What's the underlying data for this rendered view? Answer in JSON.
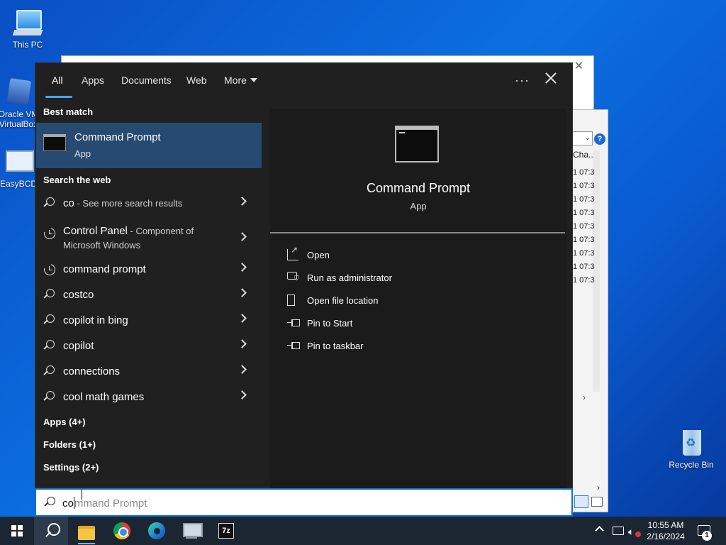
{
  "desktop": {
    "icons": [
      {
        "label": "This PC"
      },
      {
        "label": "Oracle VM VirtualBox"
      },
      {
        "label": "EasyBCD"
      },
      {
        "label": "Recycle Bin"
      }
    ],
    "background_window": {
      "column_header": "Cha...",
      "times": [
        "1 07:3",
        "1 07:3",
        "1 07:3",
        "1 07:3",
        "1 07:3",
        "1 07:3",
        "1 07:3",
        "1 07:3",
        "1 07:3"
      ]
    }
  },
  "search": {
    "tabs": [
      {
        "label": "All",
        "active": true
      },
      {
        "label": "Apps"
      },
      {
        "label": "Documents"
      },
      {
        "label": "Web"
      },
      {
        "label": "More"
      }
    ],
    "more_options": "···",
    "sections": {
      "best_match": "Best match",
      "search_web": "Search the web",
      "apps": "Apps (4+)",
      "folders": "Folders (1+)",
      "settings": "Settings (2+)"
    },
    "best_match": {
      "title": "Command Prompt",
      "subtitle": "App"
    },
    "web_results": [
      {
        "icon": "search-icon",
        "text": "co",
        "suffix": " - See more search results"
      },
      {
        "icon": "history-icon",
        "text": "Control Panel",
        "suffix": " - Component of",
        "line2": "Microsoft Windows"
      },
      {
        "icon": "history-icon",
        "text": "command prompt"
      },
      {
        "icon": "search-icon",
        "text": "costco"
      },
      {
        "icon": "search-icon",
        "text": "copilot in bing"
      },
      {
        "icon": "search-icon",
        "text": "copilot"
      },
      {
        "icon": "search-icon",
        "text": "connections"
      },
      {
        "icon": "search-icon",
        "text": "cool math games"
      }
    ],
    "preview": {
      "title": "Command Prompt",
      "subtitle": "App",
      "actions": [
        {
          "icon": "open-icon",
          "label": "Open"
        },
        {
          "icon": "run-as-admin-icon",
          "label": "Run as administrator"
        },
        {
          "icon": "file-location-icon",
          "label": "Open file location"
        },
        {
          "icon": "pin-icon",
          "label": "Pin to Start"
        },
        {
          "icon": "pin-icon",
          "label": "Pin to taskbar"
        }
      ]
    },
    "query": {
      "typed": "co",
      "completion": "mmand Prompt"
    }
  },
  "taskbar": {
    "clock_time": "10:55 AM",
    "clock_date": "2/16/2024",
    "notification_count": "1",
    "sevenzip_label": "7z"
  },
  "colors": {
    "flyout_bg": "#202020",
    "selection": "#264a71",
    "accent": "#4aa3ff",
    "taskbar": "#1c2633"
  }
}
